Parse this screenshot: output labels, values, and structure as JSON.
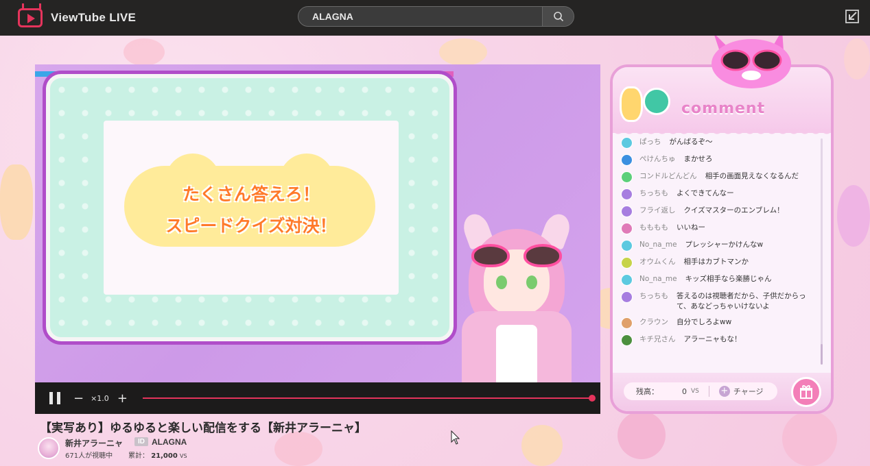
{
  "topbar": {
    "app_name": "ViewTube  LIVE",
    "search_value": "ALAGNA"
  },
  "player": {
    "quiz_line1": "たくさん答えろ！",
    "quiz_line2": "スピードクイズ対決！",
    "speed_label": "×1.0",
    "progress": 1.0
  },
  "video": {
    "title": "【実写あり】ゆるゆると楽しい配信をする【新井アラーニャ】",
    "channel_name": "新井アラーニャ",
    "id_badge": "ID",
    "channel_id": "ALAGNA",
    "viewers": "671人が視聴中",
    "total_label": "累計：",
    "total_value": "21,000",
    "total_unit": "VS"
  },
  "chat": {
    "title": "comment",
    "messages": [
      {
        "user": "ぱっち",
        "text": "がんばるぞ〜",
        "color": "#5cc9e0"
      },
      {
        "user": "ぺけんちゅ",
        "text": "まかせろ",
        "color": "#3b8fe0"
      },
      {
        "user": "コンドルどんどん",
        "text": "相手の画面見えなくなるんだ",
        "color": "#5ccf7a"
      },
      {
        "user": "ちっちも",
        "text": "よくできてんなー",
        "color": "#a77de0"
      },
      {
        "user": "フライ返し",
        "text": "クイズマスターのエンブレム！",
        "color": "#a77de0"
      },
      {
        "user": "もももも",
        "text": "いいねー",
        "color": "#e07ab8"
      },
      {
        "user": "No_na_me",
        "text": "プレッシャーかけんなw",
        "color": "#5cc9e0"
      },
      {
        "user": "オウムくん",
        "text": "相手はカブトマンか",
        "color": "#c7d34a"
      },
      {
        "user": "No_na_me",
        "text": "キッズ相手なら楽勝じゃん",
        "color": "#5cc9e0"
      },
      {
        "user": "ちっちも",
        "text": "答えるのは視聴者だから、子供だからって、あなどっちゃいけないよ",
        "color": "#a77de0"
      },
      {
        "user": "クラウン",
        "text": "自分でしろよww",
        "color": "#e0a06b"
      },
      {
        "user": "キチ兄さん",
        "text": "アラーニャもな！",
        "color": "#4c8f3e"
      }
    ],
    "balance_label": "残高：",
    "balance_value": "0",
    "balance_unit": "VS",
    "charge_label": "チャージ"
  }
}
